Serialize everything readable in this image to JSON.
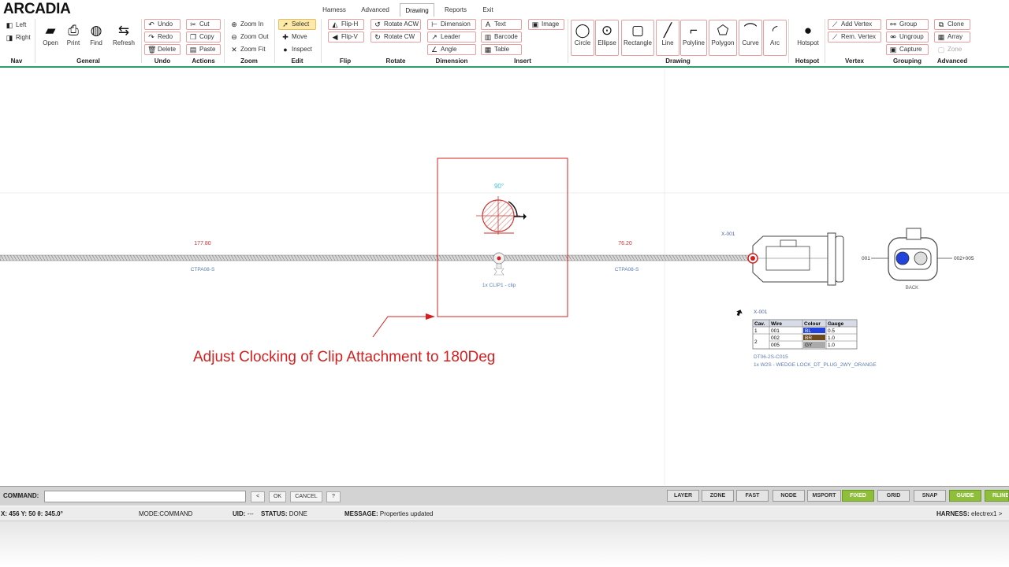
{
  "app": {
    "logo": "ARCADIA"
  },
  "tabs": [
    "Harness",
    "Advanced",
    "Drawing",
    "Reports",
    "Exit"
  ],
  "active_tab": "Drawing",
  "ribbon": {
    "nav": {
      "label": "Nav",
      "left": "Left",
      "right": "Right"
    },
    "general": {
      "label": "General",
      "open": "Open",
      "print": "Print",
      "find": "Find",
      "refresh": "Refresh"
    },
    "undo": {
      "label": "Undo",
      "undo": "Undo",
      "redo": "Redo",
      "delete": "Delete"
    },
    "actions": {
      "label": "Actions",
      "cut": "Cut",
      "copy": "Copy",
      "paste": "Paste"
    },
    "zoom": {
      "label": "Zoom",
      "zoom_in": "Zoom In",
      "zoom_out": "Zoom Out",
      "zoom_fit": "Zoom Fit"
    },
    "edit": {
      "label": "Edit",
      "select": "Select",
      "move": "Move",
      "inspect": "Inspect"
    },
    "flip": {
      "label": "Flip",
      "flip_h": "Flip-H",
      "flip_v": "Flip-V"
    },
    "rotate": {
      "label": "Rotate",
      "acw": "Rotate ACW",
      "cw": "Rotate CW"
    },
    "dimension": {
      "label": "Dimension",
      "dimension": "Dimension",
      "leader": "Leader",
      "angle": "Angle"
    },
    "insert": {
      "label": "Insert",
      "text": "Text",
      "barcode": "Barcode",
      "table": "Table",
      "image": "Image"
    },
    "drawing": {
      "label": "Drawing",
      "circle": "Circle",
      "ellipse": "Ellipse",
      "rectangle": "Rectangle",
      "line": "Line",
      "polyline": "Polyline",
      "polygon": "Polygon",
      "curve": "Curve",
      "arc": "Arc"
    },
    "hotspot": {
      "label": "Hotspot",
      "hotspot": "Hotspot"
    },
    "vertex": {
      "label": "Vertex",
      "add": "Add Vertex",
      "rem": "Rem. Vertex"
    },
    "grouping": {
      "label": "Grouping",
      "group": "Group",
      "ungroup": "Ungroup",
      "capture": "Capture"
    },
    "advanced": {
      "label": "Advanced",
      "clone": "Clone",
      "array": "Array",
      "zone": "Zone"
    }
  },
  "drawing": {
    "dim_left": "177.80",
    "dim_right": "76.20",
    "cable_left": "CTPA08-S",
    "cable_right": "CTPA08-S",
    "clip_angle": "90°",
    "clip_label": "1x CLIP1 - clip",
    "connector_id": "X-001",
    "pin_left": "001",
    "pin_right": "002+005",
    "back_label": "BACK",
    "annotation": "Adjust Clocking of Clip Attachment to 180Deg",
    "table_title": "X-001",
    "table_headers": [
      "Cav.",
      "Wire",
      "Colour",
      "Gauge"
    ],
    "table_rows": [
      {
        "cav": "1",
        "wire": "001",
        "colour": "BL",
        "gauge": "0.5"
      },
      {
        "cav": "2",
        "wire": "002",
        "colour": "BR",
        "gauge": "1.0"
      },
      {
        "cav": "",
        "wire": "005",
        "colour": "GY",
        "gauge": "1.0"
      }
    ],
    "part_number": "DT06-2S-C015",
    "part_desc": "1x W2S - WEDGE LOCK_DT_PLUG_2WY_ORANGE"
  },
  "colors": {
    "blue": "#2244dd",
    "brown": "#6b4a1e",
    "grey": "#aaaaaa",
    "accent": "#2aa06a",
    "red": "#d32020"
  },
  "command": {
    "label": "COMMAND:",
    "value": "",
    "buttons": [
      "<",
      "OK",
      "CANCEL",
      "?"
    ]
  },
  "toggles": [
    {
      "label": "LAYER",
      "on": false
    },
    {
      "label": "ZONE",
      "on": false
    },
    {
      "label": "FAST",
      "on": false
    },
    {
      "label": "NODE",
      "on": false
    },
    {
      "label": "MSPORT",
      "on": false
    },
    {
      "label": "FIXED",
      "on": true
    },
    {
      "label": "GRID",
      "on": false
    },
    {
      "label": "SNAP",
      "on": false
    },
    {
      "label": "GUIDE",
      "on": true
    },
    {
      "label": "RLINE",
      "on": true
    }
  ],
  "status": {
    "coords_label": "X: 456 Y: 50 θ: 345.0°",
    "mode_key": "MODE:",
    "mode": "COMMAND",
    "uid_key": "UID:",
    "uid": "---",
    "status_key": "STATUS:",
    "status": "DONE",
    "message_key": "MESSAGE:",
    "message": "Properties updated",
    "harness_key": "HARNESS:",
    "harness": "electrex1 >"
  }
}
